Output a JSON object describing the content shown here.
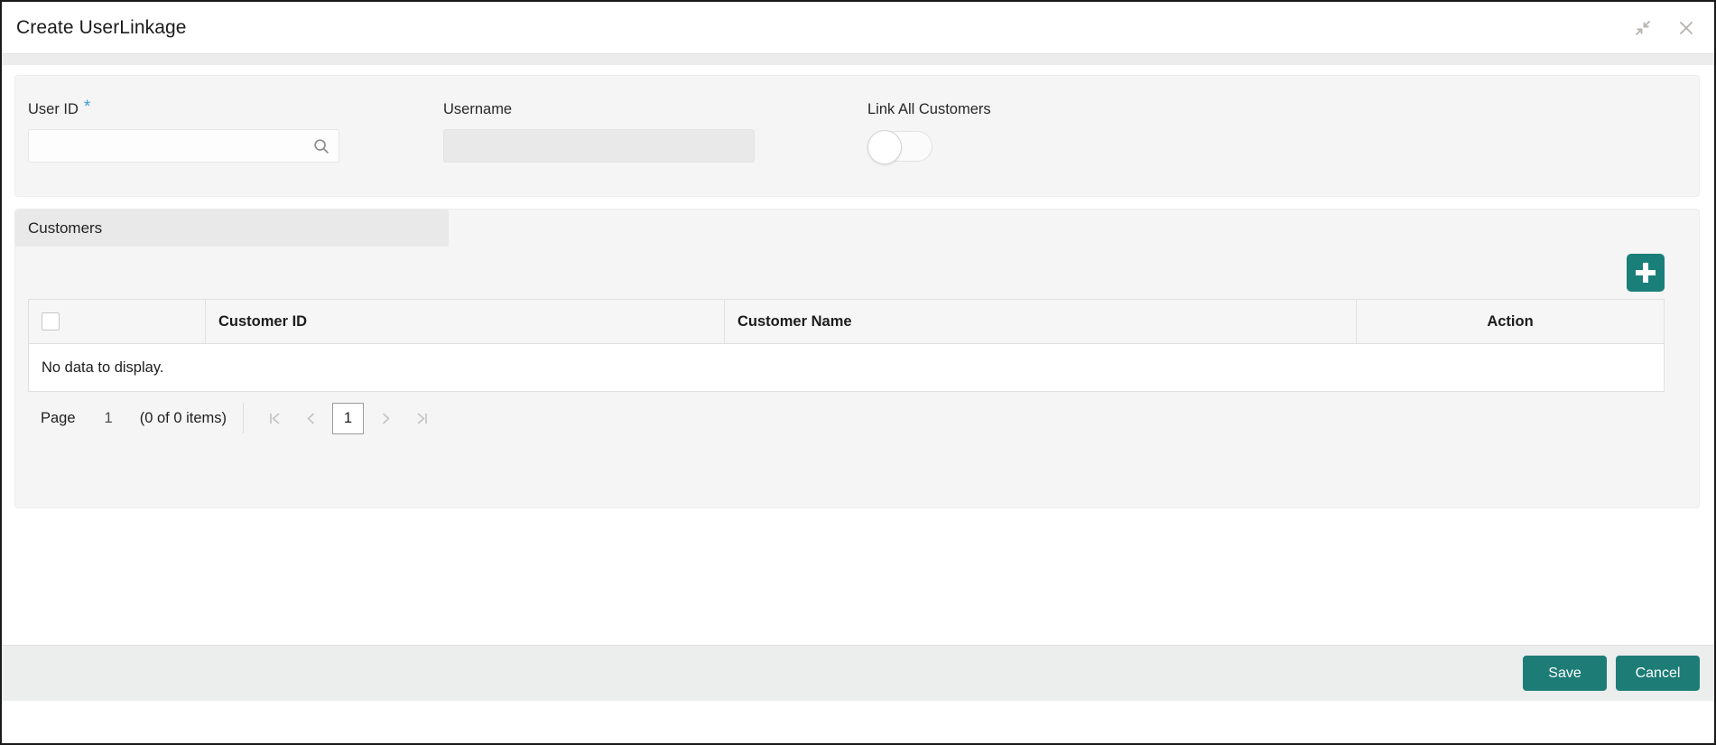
{
  "window": {
    "title": "Create UserLinkage",
    "collapse_icon": "collapse-arrows-icon",
    "close_icon": "close-icon"
  },
  "form": {
    "user_id": {
      "label": "User ID",
      "required_marker": "*",
      "value": "",
      "placeholder": "",
      "search_icon": "search-icon"
    },
    "username": {
      "label": "Username",
      "value": "",
      "placeholder": "",
      "disabled": true
    },
    "link_all_customers": {
      "label": "Link All Customers",
      "state": "off"
    }
  },
  "customers": {
    "section_title": "Customers",
    "add_button": {
      "label": "+",
      "icon": "plus-icon"
    },
    "table": {
      "columns": [
        "",
        "Customer ID",
        "Customer Name",
        "Action"
      ],
      "rows": [],
      "empty_message": "No data to display."
    },
    "pagination": {
      "page_label": "Page",
      "page_number": "1",
      "items_text": "(0 of 0 items)",
      "first_icon": "⧏|",
      "first_label": "K",
      "prev_label": "‹",
      "current_page": "1",
      "next_label": "›",
      "last_label": "⯈"
    }
  },
  "footer": {
    "save_label": "Save",
    "cancel_label": "Cancel"
  },
  "colors": {
    "accent_teal": "#1d7d76",
    "required_blue": "#3e9fd6",
    "panel_grey": "#f5f5f5",
    "header_grey": "#e9e9e9"
  }
}
